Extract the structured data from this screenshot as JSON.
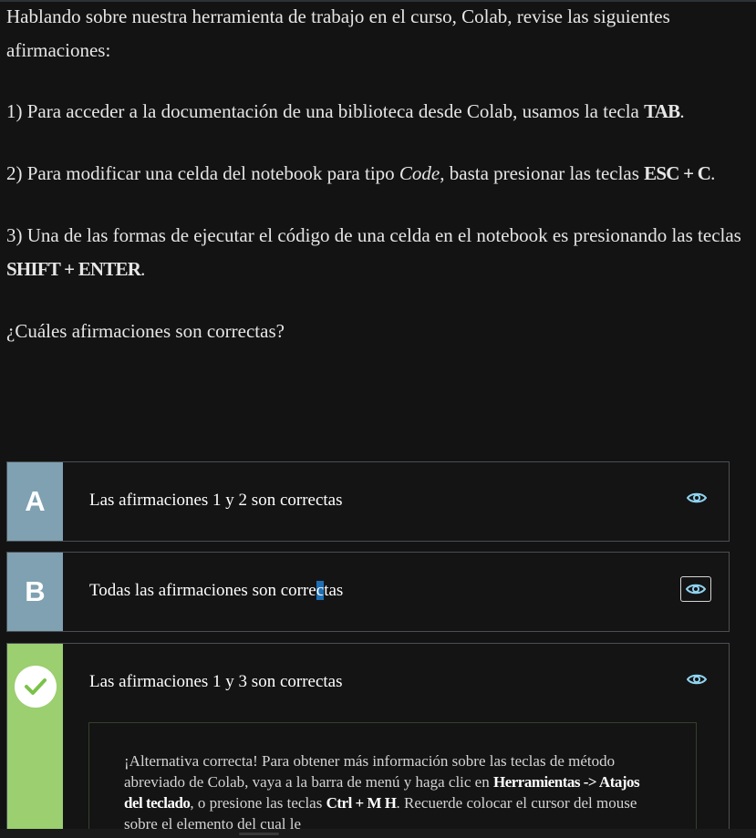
{
  "question": {
    "intro": "Hablando sobre nuestra herramienta de trabajo en el curso, Colab, revise las siguientes afirmaciones:",
    "s1_text": "1) Para acceder a la documentación de una biblioteca desde Colab, usamos la tecla ",
    "s1_key": "TAB",
    "s1_end": ".",
    "s2_a": "2) Para modificar una celda del notebook para tipo ",
    "s2_code": "Code",
    "s2_b": ", basta presionar las teclas ",
    "s2_key": "ESC + C",
    "s2_end": ".",
    "s3_text": "3) Una de las formas de ejecutar el código de una celda en el notebook es presionando las teclas ",
    "s3_key": "SHIFT + ENTER",
    "s3_end": ".",
    "prompt": "¿Cuáles afirmaciones son correctas?"
  },
  "options": [
    {
      "letter": "A",
      "text": "Las afirmaciones 1 y 2 son correctas",
      "eye_icon": "eye-icon"
    },
    {
      "letter": "B",
      "text_before": "Todas las afirmaciones son corre",
      "text_selected": "c",
      "text_after": "tas",
      "eye_icon": "eye-icon"
    },
    {
      "letter": "",
      "text": "Las afirmaciones 1 y 3 son correctas",
      "status_icon": "check-icon",
      "eye_icon": "eye-icon"
    }
  ],
  "feedback": {
    "p1": "¡Alternativa correcta! Para obtener más información sobre las teclas de método abreviado de Colab, vaya a la barra de menú y haga clic en ",
    "menu_path": "Herramientas -> Atajos del teclado",
    "p2": ", o presione las teclas ",
    "keys": "Ctrl + M H",
    "p3": ". Recuerde colocar el cursor del mouse sobre el elemento del cual le"
  },
  "colors": {
    "background": "#131313",
    "letter_column": "#7fa1b2",
    "correct_column": "#9bcf6f",
    "eye_icon": "#8fd3f0",
    "check_mark": "#7cc24a",
    "selection": "#1f6fb5"
  }
}
